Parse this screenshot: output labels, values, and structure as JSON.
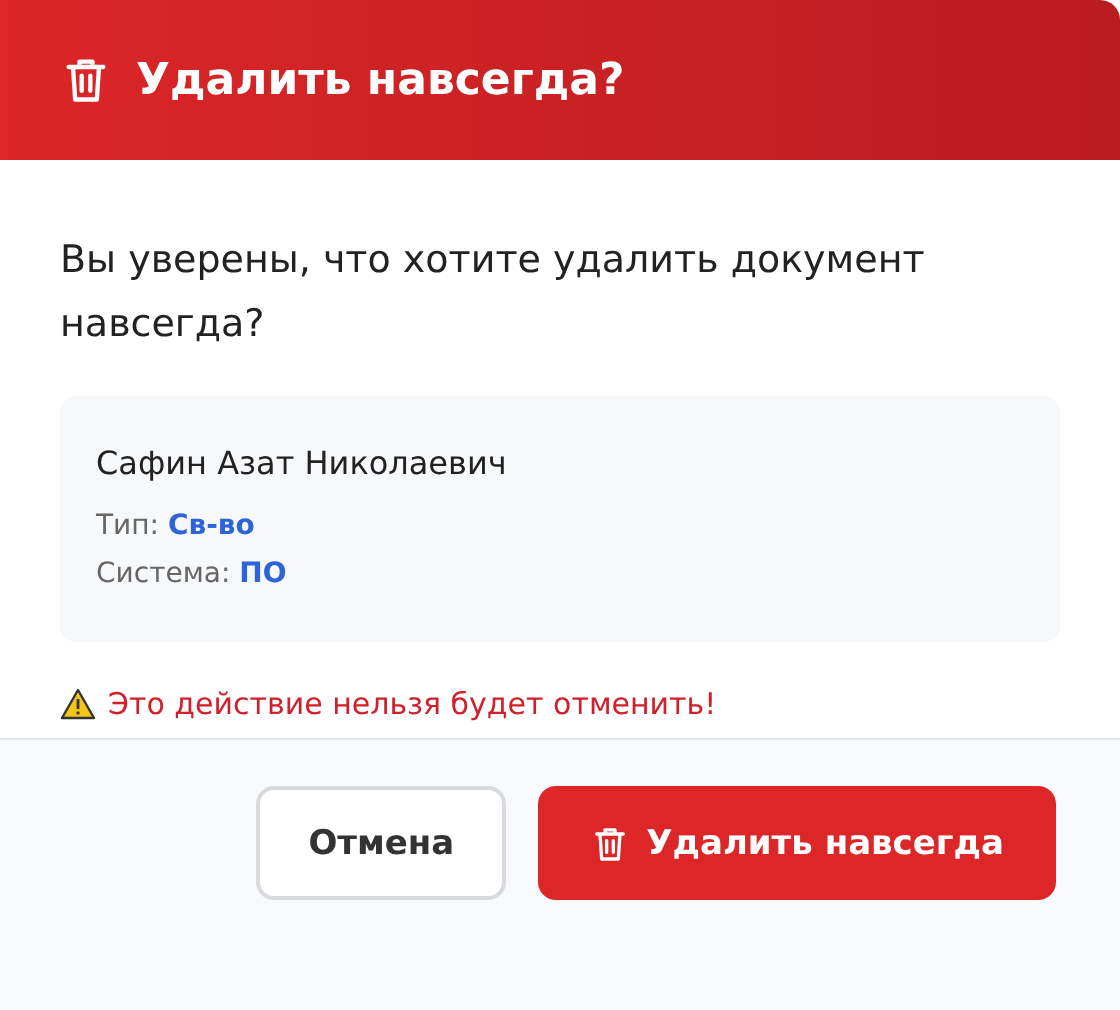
{
  "dialog": {
    "title": "Удалить навсегда?",
    "message": "Вы уверены, что хотите удалить документ навсегда?",
    "document": {
      "name": "Сафин Азат Николаевич",
      "fields": [
        {
          "label": "Тип:",
          "value": "Св-во"
        },
        {
          "label": "Система:",
          "value": "ПО"
        }
      ]
    },
    "warning": "Это действие нельзя будет отменить!",
    "buttons": [
      {
        "label": "Отмена",
        "kind": "secondary"
      },
      {
        "label": "Удалить навсегда",
        "kind": "danger"
      }
    ]
  }
}
